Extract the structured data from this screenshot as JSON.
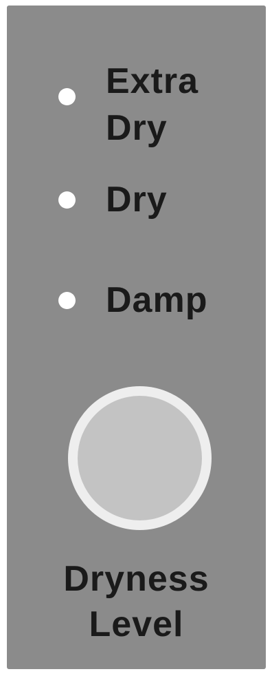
{
  "options": [
    {
      "id": "extra-dry",
      "label_line1": "Extra",
      "label_line2": "Dry",
      "indicator_color": "#ffffff"
    },
    {
      "id": "dry",
      "label": "Dry",
      "indicator_color": "#ffffff"
    },
    {
      "id": "damp",
      "label": "Damp",
      "indicator_color": "#ffffff"
    }
  ],
  "button": {
    "label_line1": "Dryness",
    "label_line2": "Level"
  },
  "colors": {
    "panel": "#8b8b8b",
    "text": "#1a1a1a",
    "indicator": "#ffffff",
    "button_ring": "#eeeeee",
    "button_face": "#c3c3c3"
  }
}
